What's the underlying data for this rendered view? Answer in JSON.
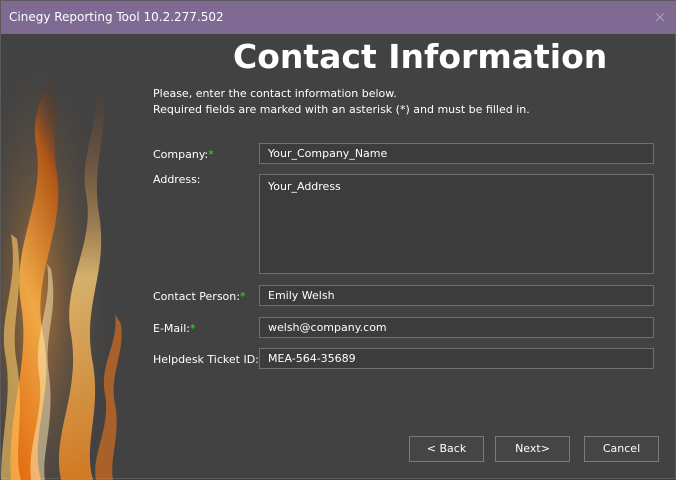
{
  "window": {
    "title": "Cinegy Reporting Tool 10.2.277.502",
    "close_glyph": "×"
  },
  "page": {
    "heading": "Contact Information",
    "intro_line1": "Please, enter the contact information below.",
    "intro_line2": "Required fields are marked with an asterisk (*) and must be filled in."
  },
  "form": {
    "required_marker": "*",
    "company": {
      "label": "Company:",
      "value": "Your_Company_Name"
    },
    "address": {
      "label": "Address:",
      "value": "Your_Address"
    },
    "contact_person": {
      "label": "Contact Person:",
      "value": "Emily Welsh"
    },
    "email": {
      "label": "E-Mail:",
      "value": "welsh@company.com"
    },
    "ticket": {
      "label": "Helpdesk Ticket ID:",
      "value": "MEA-564-35689"
    }
  },
  "buttons": {
    "back": "< Back",
    "next": "Next>",
    "cancel": "Cancel"
  },
  "colors": {
    "titlebar": "#7f6a94",
    "background": "#424242",
    "required_asterisk": "#33dd33",
    "field_border": "#6f6f6f"
  }
}
